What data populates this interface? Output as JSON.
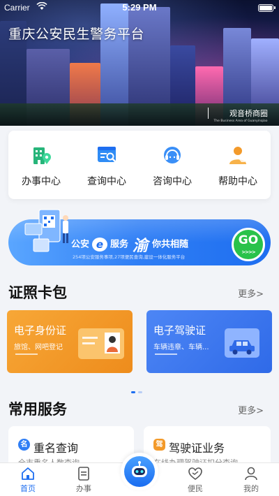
{
  "status_bar": {
    "carrier": "Carrier",
    "time": "5:29 PM"
  },
  "hero": {
    "title": "重庆公安民生警务平台",
    "location_name": "观音桥商圈",
    "location_sub": "The Business Area of Guanyinqiao"
  },
  "quick_menu": [
    {
      "label": "办事中心",
      "icon": "building-pin-icon"
    },
    {
      "label": "查询中心",
      "icon": "search-window-icon"
    },
    {
      "label": "咨询中心",
      "icon": "headset-icon"
    },
    {
      "label": "帮助中心",
      "icon": "helper-icon"
    }
  ],
  "banner": {
    "text_left": "公安",
    "e_char": "e",
    "text_service": "服务",
    "yu_char": "渝",
    "text_right": "你共相随",
    "subtext": "254项公安服务事项,27项便民查询,建设一体化服务平台",
    "go_label": "GO",
    "go_arrows": ">>>>"
  },
  "cert_section": {
    "title": "证照卡包",
    "more": "更多>",
    "cards": [
      {
        "title": "电子身份证",
        "desc": "旅馆、网吧登记"
      },
      {
        "title": "电子驾驶证",
        "desc": "车辆违章、车辆..."
      }
    ]
  },
  "services_section": {
    "title": "常用服务",
    "more": "更多>",
    "items": [
      {
        "badge": "名",
        "name": "重名查询",
        "desc": "全市重名人数查询"
      },
      {
        "badge": "驾",
        "name": "驾驶证业务",
        "desc": "在线办理驾驶证扣分查询"
      }
    ]
  },
  "tab_bar": [
    {
      "label": "首页",
      "active": true
    },
    {
      "label": "办事",
      "active": false
    },
    {
      "label": "便民",
      "active": false
    },
    {
      "label": "我的",
      "active": false
    }
  ],
  "colors": {
    "primary": "#1e6ef0",
    "id_card": "#f39a2a",
    "license_card": "#3d79ee",
    "go_button": "#29c24a"
  }
}
